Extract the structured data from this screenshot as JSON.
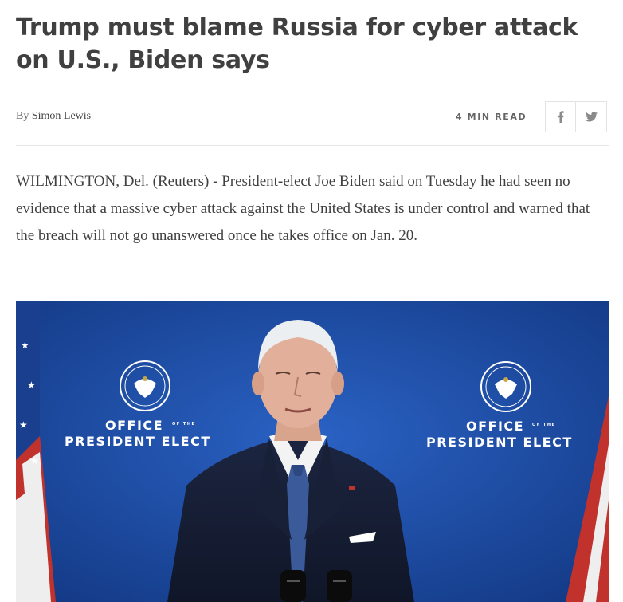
{
  "article": {
    "headline": "Trump must blame Russia for cyber attack on U.S., Biden says",
    "byline_prefix": "By",
    "author": "Simon Lewis",
    "read_time": "4 MIN READ",
    "body": "WILMINGTON, Del. (Reuters) - President-elect Joe Biden said on Tuesday he had seen no evidence that a massive cyber attack against the United States is under control and warned that the breach will not go unanswered once he takes office on Jan. 20."
  },
  "share": {
    "facebook_icon": "facebook-icon",
    "twitter_icon": "twitter-icon"
  },
  "photo": {
    "backdrop_left_line1": "OFFICE",
    "backdrop_left_line2": "PRESIDENT ELECT",
    "backdrop_right_line1": "OFFICE",
    "backdrop_right_line2": "PRESIDENT ELECT",
    "of_the": "OF THE"
  },
  "colors": {
    "text": "#404040",
    "muted": "#666666",
    "backdrop_blue": "#1d4a9f"
  }
}
